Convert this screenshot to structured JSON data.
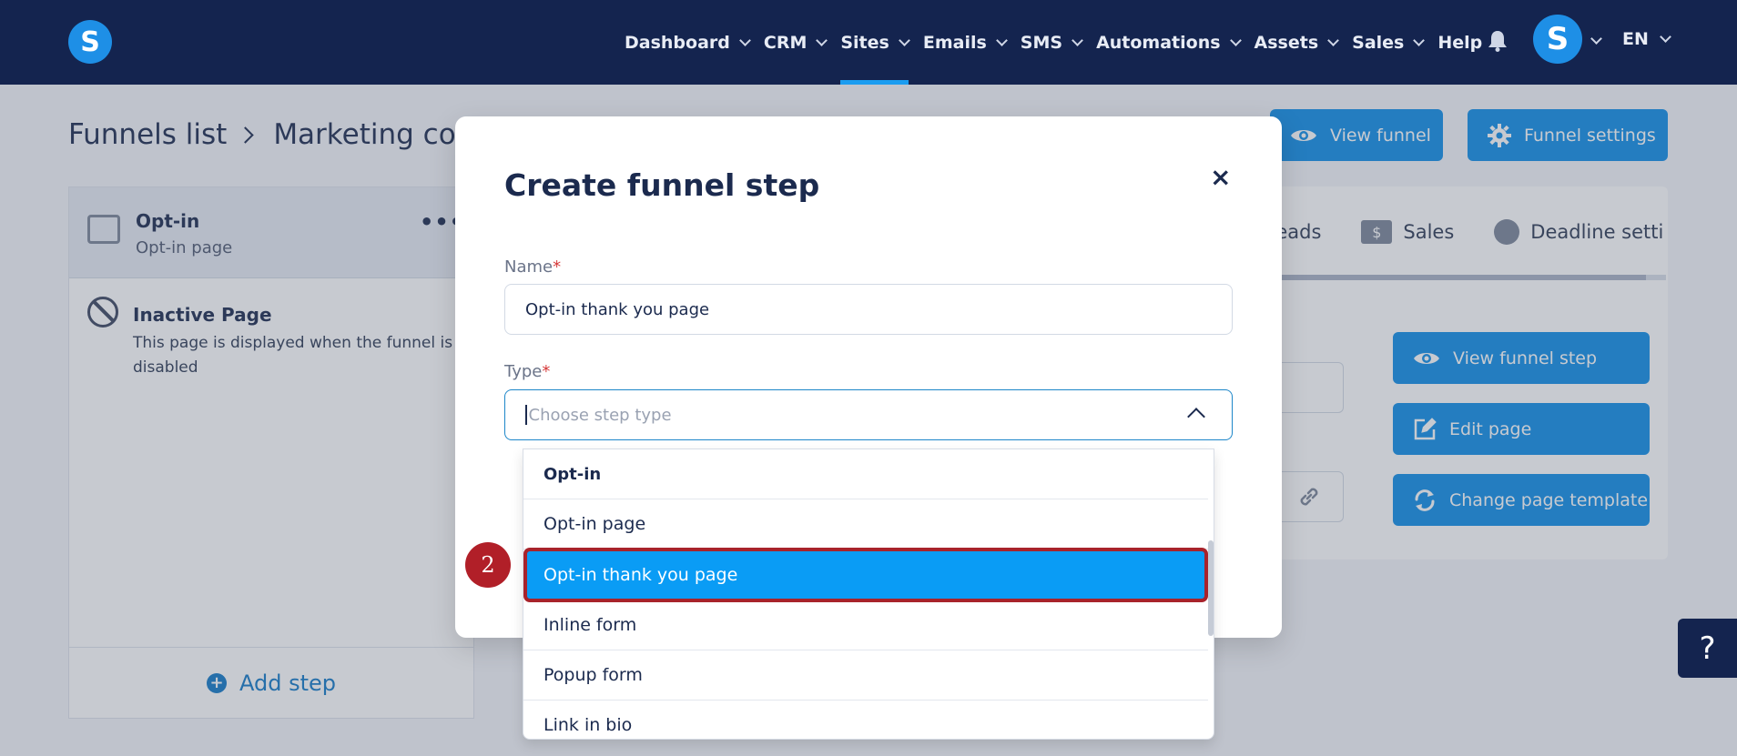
{
  "nav": {
    "logo_letter": "S",
    "items": [
      {
        "label": "Dashboard",
        "has_menu": true
      },
      {
        "label": "CRM",
        "has_menu": true
      },
      {
        "label": "Sites",
        "has_menu": true,
        "active": true
      },
      {
        "label": "Emails",
        "has_menu": true
      },
      {
        "label": "SMS",
        "has_menu": true
      },
      {
        "label": "Automations",
        "has_menu": true
      },
      {
        "label": "Assets",
        "has_menu": true
      },
      {
        "label": "Sales",
        "has_menu": true
      },
      {
        "label": "Help",
        "has_menu": false
      }
    ],
    "avatar_letter": "S",
    "language": "EN"
  },
  "page": {
    "breadcrumb": {
      "root": "Funnels list",
      "current": "Marketing cour"
    },
    "view_funnel_label": "View funnel",
    "funnel_settings_label": "Funnel settings"
  },
  "sidebar": {
    "step_title": "Opt-in",
    "step_subtitle": "Opt-in page",
    "more_label": "•••",
    "inactive_title": "Inactive Page",
    "inactive_text": "This page is displayed when the funnel is disabled",
    "add_step_label": "Add step"
  },
  "right_panel": {
    "tabs": [
      "Leads",
      "Sales",
      "Deadline setti"
    ],
    "dollar_glyph": "$",
    "view_step_label": "View funnel step",
    "edit_page_label": "Edit page",
    "change_template_label": "Change page template"
  },
  "modal": {
    "title": "Create funnel step",
    "close_glyph": "×",
    "name_label": "Name",
    "name_value": "Opt-in thank you page",
    "type_label": "Type",
    "required_mark": "*",
    "type_placeholder": "Choose step type"
  },
  "dropdown": {
    "group_label": "Opt-in",
    "options": [
      "Opt-in page",
      "Opt-in thank you page",
      "Inline form",
      "Popup form",
      "Link in bio"
    ],
    "selected": "Opt-in thank you page"
  },
  "annotation_badge": "2",
  "help_glyph": "?",
  "colors": {
    "nav_bg": "#14244f",
    "accent": "#0f8ee8",
    "selected_bg": "#0a9cf5",
    "highlight_border": "#a8232b"
  }
}
